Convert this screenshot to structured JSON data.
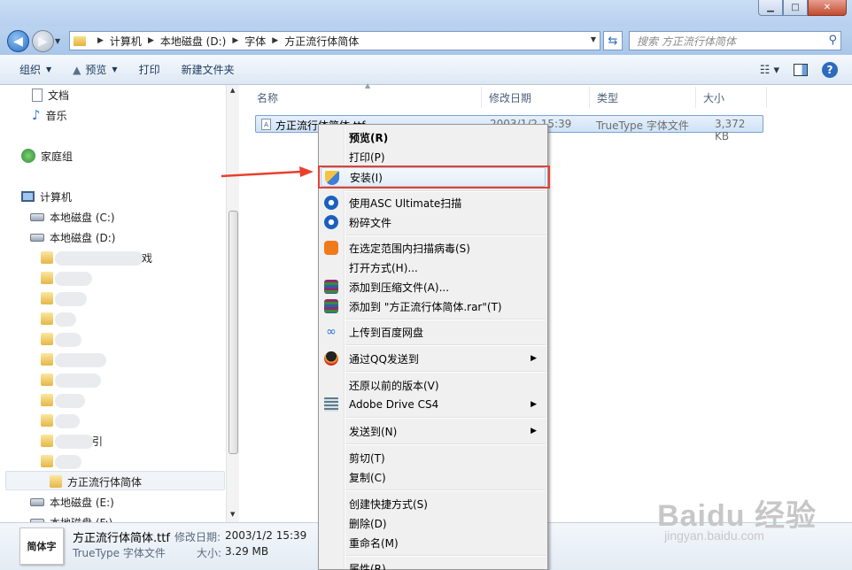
{
  "window": {
    "minimize": "▁",
    "maximize": "□",
    "close": "✕"
  },
  "address": {
    "crumbs": [
      "计算机",
      "本地磁盘 (D:)",
      "字体",
      "方正流行体简体"
    ],
    "search_placeholder": "搜索 方正流行体简体"
  },
  "toolbar": {
    "organize": "组织",
    "preview": "预览",
    "print": "打印",
    "new_folder": "新建文件夹"
  },
  "nav": {
    "documents": "文档",
    "music": "音乐",
    "homegroup": "家庭组",
    "computer": "计算机",
    "drive_c": "本地磁盘 (C:)",
    "drive_d": "本地磁盘 (D:)",
    "blurred_tail_1": "戏",
    "blurred_tail_2": "引",
    "selected_folder": "方正流行体简体",
    "drive_e": "本地磁盘 (E:)",
    "drive_f": "本地磁盘 (F:)"
  },
  "columns": {
    "name": "名称",
    "modified": "修改日期",
    "type": "类型",
    "size": "大小"
  },
  "file": {
    "name": "方正流行体简体.ttf",
    "modified": "2003/1/2 15:39",
    "type": "TrueType 字体文件",
    "size": "3,372 KB"
  },
  "context_menu": {
    "preview": "预览(R)",
    "print": "打印(P)",
    "install": "安装(I)",
    "asc_scan": "使用ASC Ultimate扫描",
    "shred": "粉碎文件",
    "virus_scan": "在选定范围内扫描病毒(S)",
    "open_with": "打开方式(H)...",
    "add_archive": "添加到压缩文件(A)...",
    "add_rar": "添加到 \"方正流行体简体.rar\"(T)",
    "baidu_upload": "上传到百度网盘",
    "qq_send": "通过QQ发送到",
    "restore": "还原以前的版本(V)",
    "adobe_drive": "Adobe Drive CS4",
    "send_to": "发送到(N)",
    "cut": "剪切(T)",
    "copy": "复制(C)",
    "shortcut": "创建快捷方式(S)",
    "delete": "删除(D)",
    "rename": "重命名(M)",
    "properties": "属性(R)"
  },
  "details": {
    "thumb_text": "简体字",
    "name": "方正流行体简体.ttf",
    "modified_label": "修改日期:",
    "modified": "2003/1/2 15:39",
    "type": "TrueType 字体文件",
    "size_label": "大小:",
    "size": "3.29 MB"
  },
  "watermark": {
    "brand": "Baidu 经验",
    "url": "jingyan.baidu.com"
  },
  "colors": {
    "highlight": "#e8402e",
    "menu_bg": "#f0f0f0",
    "selection": "#cfe2f7"
  }
}
